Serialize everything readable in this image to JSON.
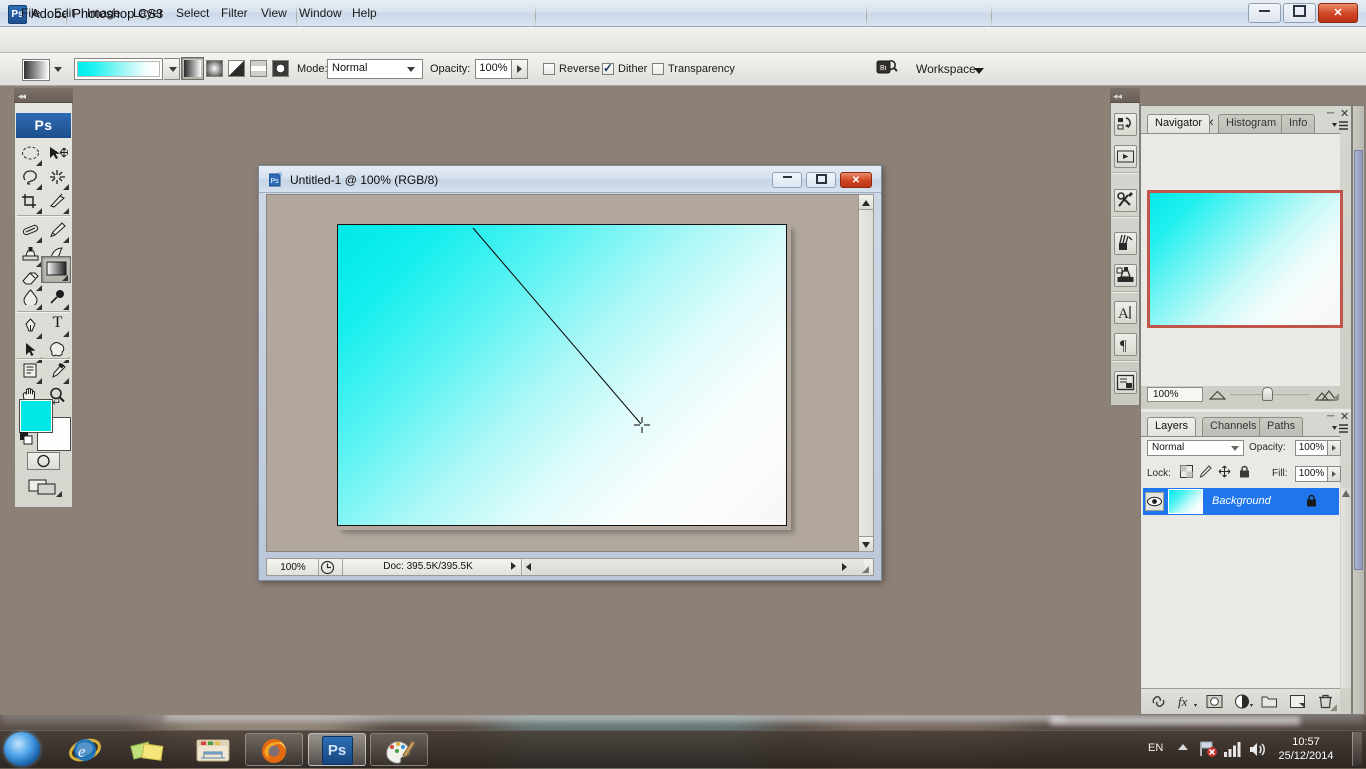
{
  "window": {
    "app_title": "Adobe Photoshop CS3",
    "app_icon": "Ps",
    "minimize_label": "–",
    "maximize_label": "□",
    "close_label": "✕"
  },
  "menubar": {
    "items": [
      {
        "label": "File"
      },
      {
        "label": "Edit"
      },
      {
        "label": "Image"
      },
      {
        "label": "Layer"
      },
      {
        "label": "Select"
      },
      {
        "label": "Filter"
      },
      {
        "label": "View"
      },
      {
        "label": "Window"
      },
      {
        "label": "Help"
      }
    ]
  },
  "options_bar": {
    "tool_preset_icon": "gradient-tool-preset",
    "gradient_preset": "cyan-to-white-linear",
    "gradient_start_color": "#00ecec",
    "gradient_end_color": "#ffffff",
    "gradient_types": [
      {
        "name": "linear-gradient",
        "selected": true
      },
      {
        "name": "radial-gradient",
        "selected": false
      },
      {
        "name": "angle-gradient",
        "selected": false
      },
      {
        "name": "reflected-gradient",
        "selected": false
      },
      {
        "name": "diamond-gradient",
        "selected": false
      }
    ],
    "mode_label": "Mode:",
    "mode_value": "Normal",
    "opacity_label": "Opacity:",
    "opacity_value": "100%",
    "checkboxes": [
      {
        "label": "Reverse",
        "checked": false
      },
      {
        "label": "Dither",
        "checked": true
      },
      {
        "label": "Transparency",
        "checked": false
      }
    ],
    "bridge_icon": "go-to-bridge-icon",
    "workspace_label": "Workspace"
  },
  "toolbox": {
    "logo": "Ps",
    "tools": [
      {
        "name": "marquee-tool"
      },
      {
        "name": "move-tool"
      },
      {
        "name": "lasso-tool"
      },
      {
        "name": "magic-wand-tool"
      },
      {
        "name": "crop-tool"
      },
      {
        "name": "slice-tool"
      },
      {
        "name": "healing-brush-tool"
      },
      {
        "name": "brush-tool"
      },
      {
        "name": "clone-stamp-tool"
      },
      {
        "name": "history-brush-tool"
      },
      {
        "name": "eraser-tool"
      },
      {
        "name": "gradient-tool"
      },
      {
        "name": "blur-tool"
      },
      {
        "name": "dodge-tool"
      },
      {
        "name": "pen-tool"
      },
      {
        "name": "type-tool"
      },
      {
        "name": "path-selection-tool"
      },
      {
        "name": "shape-tool"
      },
      {
        "name": "notes-tool"
      },
      {
        "name": "eyedropper-tool"
      },
      {
        "name": "hand-tool"
      },
      {
        "name": "zoom-tool"
      }
    ],
    "foreground_color": "#00e7e7",
    "background_color": "#fdfdfd",
    "quick_mask": "edit-in-quick-mask-mode",
    "screen_mode": "change-screen-mode"
  },
  "document": {
    "title": "Untitled-1 @ 100% (RGB/8)",
    "minimize_label": "–",
    "maximize_label": "□",
    "close_label": "✕",
    "status_zoom": "100%",
    "status_doc": "Doc: 395.5K/395.5K",
    "canvas_gradient_from": "#00e8e8",
    "canvas_gradient_to": "#f7f7f5"
  },
  "icon_dock": {
    "buttons": [
      {
        "name": "history-panel-icon"
      },
      {
        "name": "actions-panel-icon"
      },
      {
        "name": "tool-presets-panel-icon"
      },
      {
        "name": "brushes-panel-icon"
      },
      {
        "name": "clone-source-panel-icon"
      },
      {
        "name": "character-panel-icon"
      },
      {
        "name": "paragraph-panel-icon"
      },
      {
        "name": "layer-comps-panel-icon"
      }
    ]
  },
  "navigator_panel": {
    "tabs": [
      {
        "label": "Navigator",
        "active": true,
        "closable": true
      },
      {
        "label": "Histogram",
        "active": false,
        "closable": false
      },
      {
        "label": "Info",
        "active": false,
        "closable": false
      }
    ],
    "zoom_value": "100%",
    "view_box_color": "#c0564a",
    "thumb_gradient_from": "#00e8e8",
    "thumb_gradient_to": "#f4f4f2"
  },
  "layers_panel": {
    "tabs": [
      {
        "label": "Layers",
        "active": true,
        "closable": true
      },
      {
        "label": "Channels",
        "active": false,
        "closable": false
      },
      {
        "label": "Paths",
        "active": false,
        "closable": false
      }
    ],
    "blend_mode": "Normal",
    "opacity_label": "Opacity:",
    "opacity_value": "100%",
    "lock_label": "Lock:",
    "lock_icons": [
      {
        "name": "lock-transparent-pixels-icon"
      },
      {
        "name": "lock-image-pixels-icon"
      },
      {
        "name": "lock-position-icon"
      },
      {
        "name": "lock-all-icon"
      }
    ],
    "fill_label": "Fill:",
    "fill_value": "100%",
    "layers": [
      {
        "name": "Background",
        "visible": true,
        "locked": true,
        "selected": true
      }
    ],
    "selection_color": "#1f76ec",
    "bottom_buttons": [
      {
        "name": "link-layers-icon"
      },
      {
        "name": "layer-style-fx-icon"
      },
      {
        "name": "add-layer-mask-icon"
      },
      {
        "name": "new-adjustment-layer-icon"
      },
      {
        "name": "new-group-icon"
      },
      {
        "name": "new-layer-icon"
      },
      {
        "name": "delete-layer-icon"
      }
    ]
  },
  "taskbar": {
    "start_button": "windows-start-orb",
    "quick_launch": [
      {
        "name": "internet-explorer-icon"
      },
      {
        "name": "show-desktop-icon"
      },
      {
        "name": "windows-explorer-icon"
      }
    ],
    "apps": [
      {
        "name": "firefox-taskbar-button",
        "active": false
      },
      {
        "name": "photoshop-taskbar-button",
        "active": true,
        "label": "Ps"
      },
      {
        "name": "paint-taskbar-button",
        "active": false
      }
    ],
    "tray": {
      "language": "EN",
      "show_hidden_icons": "show-hidden-icons-arrow",
      "network_icon": "network-disconnected-icon",
      "signal_icon": "signal-strength-icon",
      "volume_icon": "volume-icon",
      "time": "10:57",
      "date": "25/12/2014"
    }
  }
}
